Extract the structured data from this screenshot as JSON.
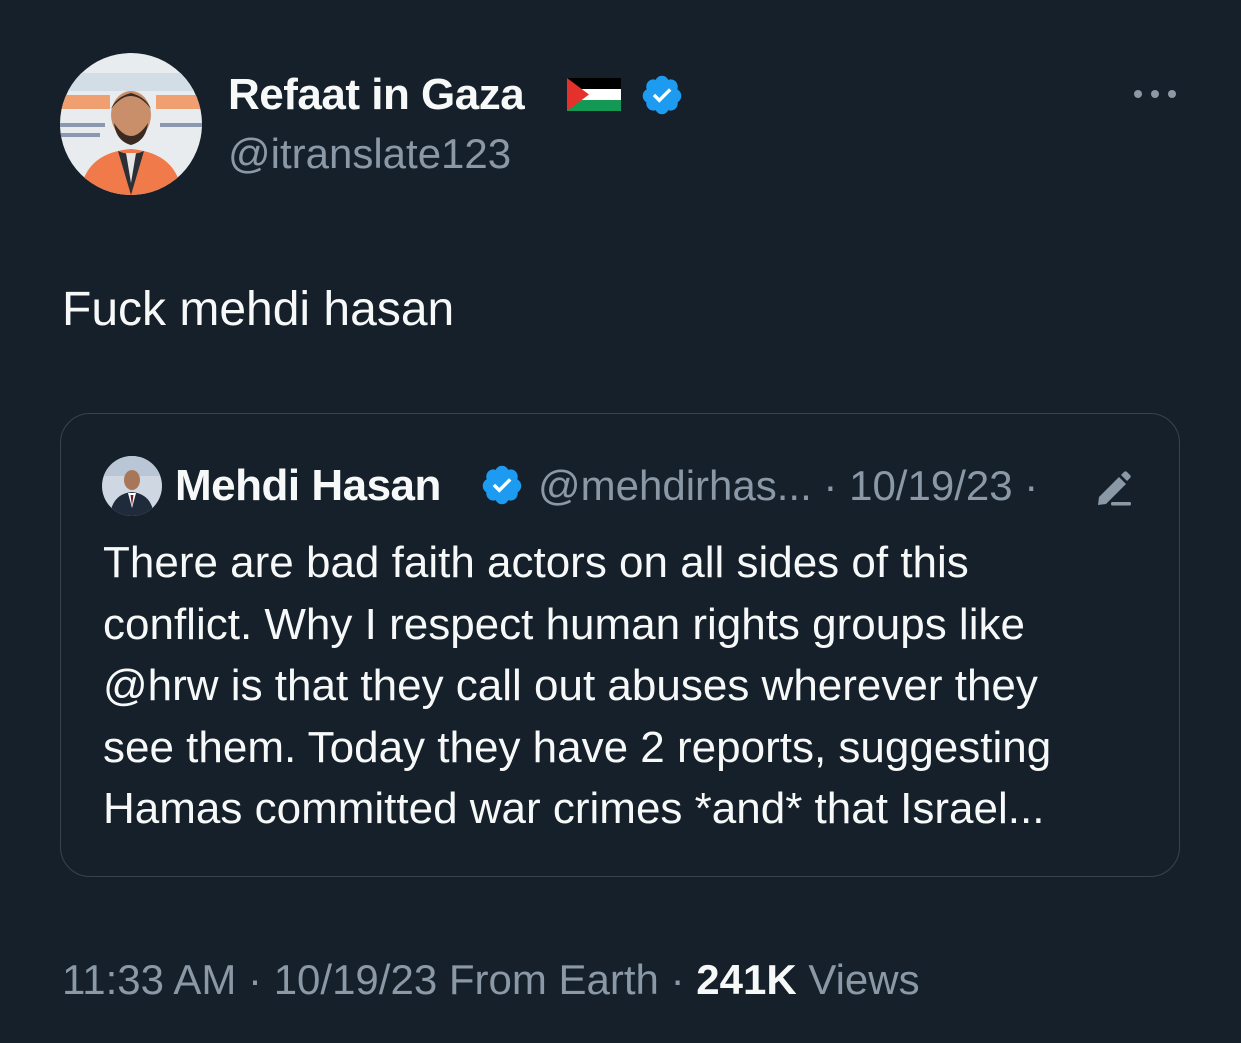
{
  "tweet": {
    "display_name": "Refaat in Gaza",
    "handle": "@itranslate123",
    "text": "Fuck mehdi hasan",
    "time": "11:33 AM",
    "date": "10/19/23",
    "source": "From Earth",
    "views_count": "241K",
    "views_label": "Views",
    "separator": "·"
  },
  "quote": {
    "display_name": "Mehdi Hasan",
    "handle": "@mehdirhas...",
    "date": "10/19/23",
    "separator": "·",
    "text_lines": [
      "There are bad faith actors on all sides of this",
      "conflict. Why I respect human rights groups like",
      "@hrw is that they call out abuses wherever they",
      "see them. Today they have 2 reports, suggesting",
      "Hamas committed war crimes *and* that Israel..."
    ]
  },
  "icons": {
    "flag": "palestine-flag-icon",
    "verified": "verified-badge-icon",
    "more": "more-options-icon",
    "edit": "edited-pencil-icon"
  },
  "colors": {
    "background": "#15202b",
    "primary_text": "#f7f9f9",
    "secondary_text": "#8b98a5",
    "verified_blue": "#1d9bf0",
    "card_border": "#38444d"
  }
}
